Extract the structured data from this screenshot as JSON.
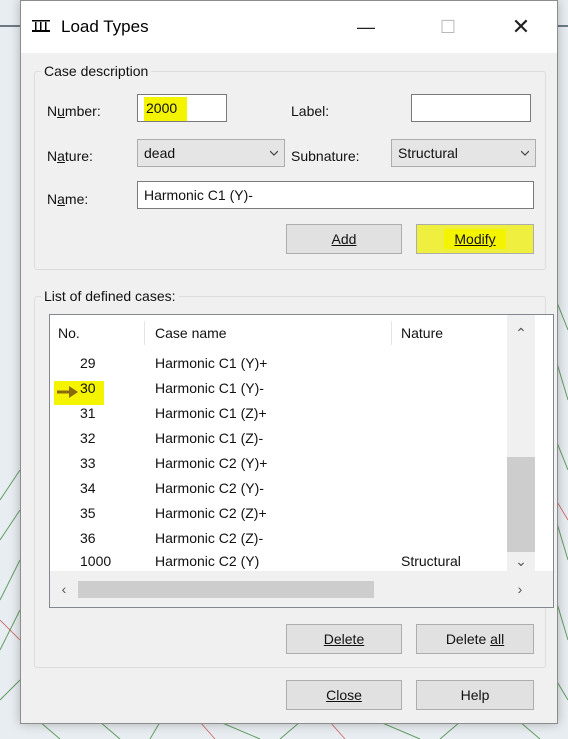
{
  "window": {
    "title": "Load Types",
    "minimize_glyph": "—",
    "maximize_glyph": "☐",
    "close_glyph": "✕"
  },
  "case_description": {
    "legend": "Case description",
    "number_label": "Number:",
    "number_value": "2000",
    "label_label": "Label:",
    "label_value": "",
    "nature_label": "Nature:",
    "nature_value": "dead",
    "subnature_label": "Subnature:",
    "subnature_value": "Structural",
    "name_label": "Name:",
    "name_value": "Harmonic C1 (Y)-",
    "add_button": "Add",
    "modify_button": "Modify"
  },
  "list": {
    "legend": "List of defined cases:",
    "columns": [
      "No.",
      "Case name",
      "Nature"
    ],
    "rows": [
      {
        "no": "29",
        "name": "Harmonic C1 (Y)+",
        "nature": ""
      },
      {
        "no": "30",
        "name": "Harmonic C1 (Y)-",
        "nature": ""
      },
      {
        "no": "31",
        "name": "Harmonic C1 (Z)+",
        "nature": ""
      },
      {
        "no": "32",
        "name": "Harmonic C1 (Z)-",
        "nature": ""
      },
      {
        "no": "33",
        "name": "Harmonic C2 (Y)+",
        "nature": ""
      },
      {
        "no": "34",
        "name": "Harmonic C2 (Y)-",
        "nature": ""
      },
      {
        "no": "35",
        "name": "Harmonic C2 (Z)+",
        "nature": ""
      },
      {
        "no": "36",
        "name": "Harmonic C2 (Z)-",
        "nature": ""
      },
      {
        "no": "1000",
        "name": "Harmonic C2 (Y)",
        "nature": "Structural"
      }
    ],
    "delete_button": "Delete",
    "delete_all_button": "Delete all"
  },
  "footer": {
    "close_button": "Close",
    "help_button": "Help"
  },
  "colors": {
    "highlight": "#f4f400",
    "arrow": "#8a6a10"
  }
}
